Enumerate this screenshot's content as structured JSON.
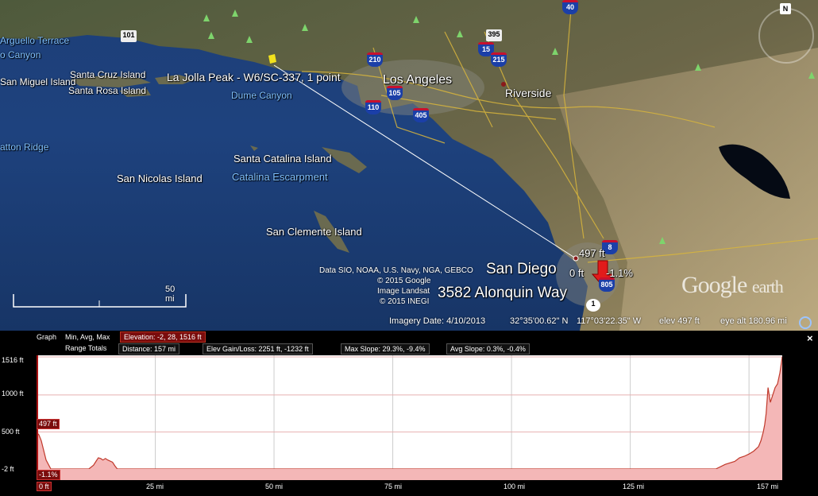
{
  "map": {
    "labels": {
      "arguello": "Arguello Terrace",
      "canyon": "o Canyon",
      "san_miguel": "San Miguel Island",
      "santa_cruz": "Santa Cruz Island",
      "santa_rosa": "Santa Rosa Island",
      "placemark": "La Jolla Peak - W6/SC-337, 1 point",
      "los_angeles": "Los Angeles",
      "dume": "Dume Canyon",
      "riverside": "Riverside",
      "patton": "atton Ridge",
      "santa_catalina": "Santa Catalina Island",
      "catalina_escarpment": "Catalina Escarpment",
      "san_nicolas": "San Nicolas Island",
      "san_clemente": "San Clemente Island",
      "san_diego": "San Diego",
      "address": "3582 Alonquin Way",
      "elev_tip": "497 ft",
      "tip_left": "0 ft",
      "tip_right": "-1.1%"
    },
    "shields": {
      "i40": "40",
      "us101": "101",
      "s395": "395",
      "i15": "15",
      "i210": "210",
      "i215": "215",
      "i105": "105",
      "i110": "110",
      "i405": "405",
      "i8": "8",
      "i805": "805",
      "s1": "1"
    },
    "credits": [
      "Data SIO, NOAA, U.S. Navy, NGA, GEBCO",
      "© 2015 Google",
      "Image Landsat",
      "© 2015 INEGI"
    ],
    "scale_label": "50 mi",
    "compass_label": "N",
    "logo": {
      "google": "Google",
      "earth": "earth"
    },
    "status": {
      "imagery_date": "Imagery Date: 4/10/2013",
      "lat": "32°35'00.62\" N",
      "lon": "117°03'22.35\" W",
      "elev": "elev   497 ft",
      "eye_alt": "eye alt 180.96 mi"
    }
  },
  "graph": {
    "graph_label": "Graph",
    "graph_mode": "Min, Avg, Max",
    "elevation": "Elevation: -2, 28, 1516 ft",
    "range_totals_label": "Range Totals",
    "distance": "Distance: 157 mi",
    "elev_gain_loss": "Elev Gain/Loss: 2251 ft, -1232 ft",
    "max_slope": "Max Slope: 29.3%, -9.4%",
    "avg_slope": "Avg Slope: 0.3%, -0.4%",
    "close": "×",
    "marker_elev": "497 ft",
    "marker_slope": "-1.1%"
  },
  "chart_data": {
    "type": "area",
    "xlabel": "",
    "ylabel": "",
    "y_ticks": [
      "1516 ft",
      "1000 ft",
      "500 ft",
      "-2 ft"
    ],
    "x_ticks": [
      "0 ft",
      "25 mi",
      "50 mi",
      "75 mi",
      "100 mi",
      "125 mi",
      "157 mi"
    ],
    "ylim": [
      -2,
      1516
    ],
    "xlim": [
      0,
      157
    ],
    "x": [
      0,
      0.5,
      1,
      1.5,
      2,
      3,
      3.5,
      4,
      11,
      12,
      12.5,
      13,
      13.5,
      14,
      14.5,
      15,
      16,
      16.5,
      17,
      143,
      145,
      147,
      148,
      149,
      150,
      151,
      152,
      152.5,
      153,
      153.3,
      153.6,
      154,
      154.5,
      155,
      155.5,
      156,
      156.5,
      157
    ],
    "values": [
      497,
      460,
      380,
      250,
      120,
      0,
      -2,
      -2,
      -2,
      50,
      100,
      150,
      140,
      120,
      140,
      120,
      90,
      40,
      -2,
      -2,
      60,
      100,
      150,
      170,
      200,
      240,
      300,
      380,
      500,
      600,
      750,
      1100,
      900,
      1000,
      1100,
      1150,
      1300,
      1516
    ],
    "grid": true
  }
}
